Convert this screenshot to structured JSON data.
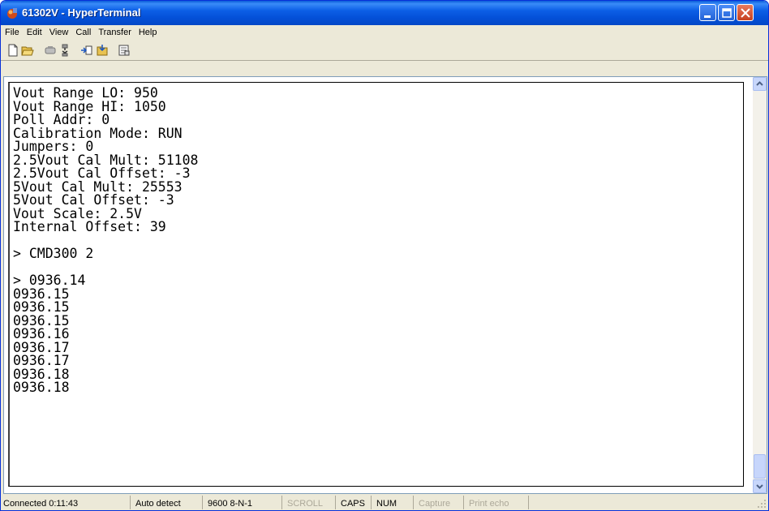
{
  "window": {
    "title": "61302V - HyperTerminal"
  },
  "menu": {
    "items": [
      "File",
      "Edit",
      "View",
      "Call",
      "Transfer",
      "Help"
    ]
  },
  "toolbar": {
    "icons": [
      "new-icon",
      "open-icon",
      "connect-icon",
      "disconnect-icon",
      "send-icon",
      "receive-icon",
      "properties-icon"
    ]
  },
  "terminal": {
    "lines": [
      "Vout Range LO: 950",
      "Vout Range HI: 1050",
      "Poll Addr: 0",
      "Calibration Mode: RUN",
      "Jumpers: 0",
      "2.5Vout Cal Mult: 51108",
      "2.5Vout Cal Offset: -3",
      "5Vout Cal Mult: 25553",
      "5Vout Cal Offset: -3",
      "Vout Scale: 2.5V",
      "Internal Offset: 39",
      "",
      "> CMD300 2",
      "",
      "> 0936.14",
      "0936.15",
      "0936.15",
      "0936.15",
      "0936.16",
      "0936.17",
      "0936.17",
      "0936.18",
      "0936.18"
    ]
  },
  "status": {
    "connected": "Connected 0:11:43",
    "detect": "Auto detect",
    "settings": "9600 8-N-1",
    "scroll": "SCROLL",
    "caps": "CAPS",
    "num": "NUM",
    "capture": "Capture",
    "print_echo": "Print echo"
  },
  "colors": {
    "title_bar": "#0450d8",
    "close_button": "#c6401e",
    "window_bg": "#ece9d8"
  }
}
